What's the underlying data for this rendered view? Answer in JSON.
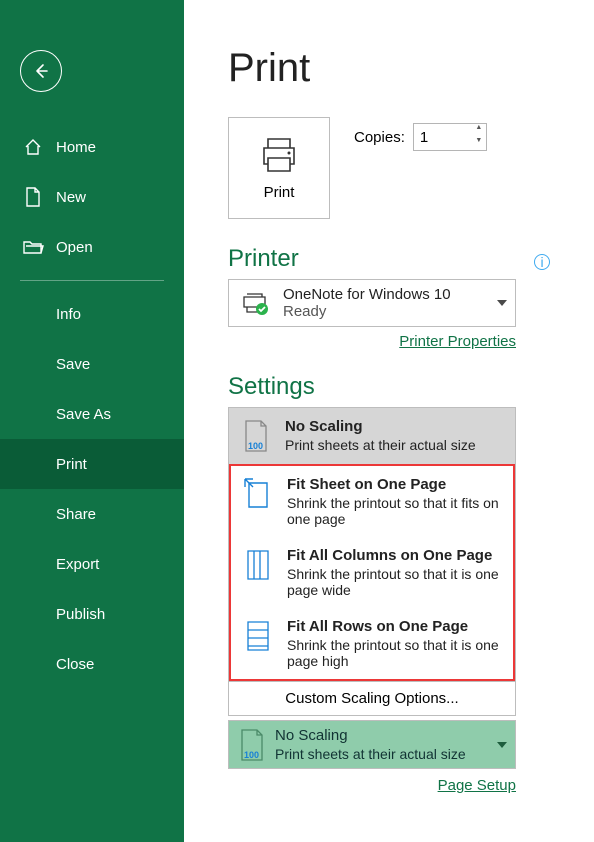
{
  "sidebar": {
    "home": "Home",
    "new": "New",
    "open": "Open",
    "items": [
      "Info",
      "Save",
      "Save As",
      "Print",
      "Share",
      "Export",
      "Publish",
      "Close"
    ],
    "active_index": 3
  },
  "main": {
    "title": "Print",
    "print_button": "Print",
    "copies_label": "Copies:",
    "copies_value": "1"
  },
  "printer": {
    "section_title": "Printer",
    "name": "OneNote for Windows 10",
    "status": "Ready",
    "properties_link": "Printer Properties"
  },
  "settings": {
    "section_title": "Settings",
    "selected": {
      "title": "No Scaling",
      "desc": "Print sheets at their actual size"
    },
    "options": [
      {
        "title": "Fit Sheet on One Page",
        "desc": "Shrink the printout so that it fits on one page"
      },
      {
        "title": "Fit All Columns on One Page",
        "desc": "Shrink the printout so that it is one page wide"
      },
      {
        "title": "Fit All Rows on One Page",
        "desc": "Shrink the printout so that it is one page high"
      }
    ],
    "custom": "Custom Scaling Options...",
    "final": {
      "title": "No Scaling",
      "desc": "Print sheets at their actual size"
    },
    "page_setup": "Page Setup"
  }
}
